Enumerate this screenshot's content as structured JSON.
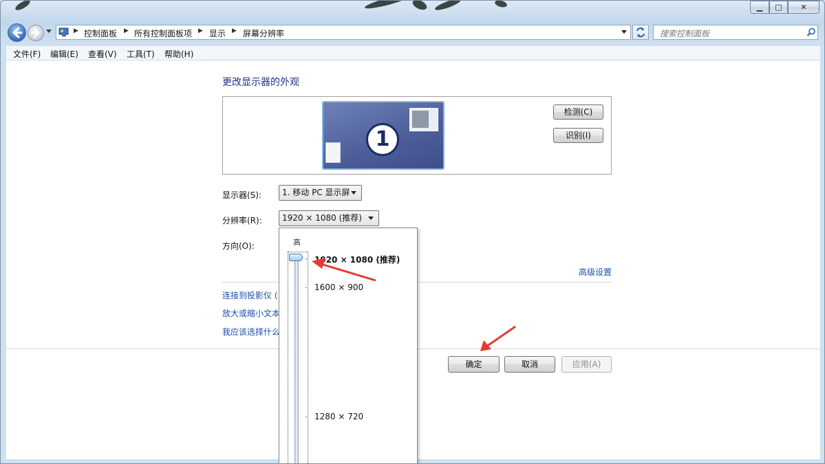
{
  "window": {
    "minimize_glyph": "▁",
    "maximize_glyph": "□",
    "close_glyph": "✕"
  },
  "address": {
    "crumbs": [
      "控制面板",
      "所有控制面板项",
      "显示",
      "屏幕分辨率"
    ],
    "dropdown_icon": "chevron-down-icon",
    "refresh_icon": "refresh-icon"
  },
  "search": {
    "placeholder": "搜索控制面板"
  },
  "menu": {
    "file": "文件(F)",
    "edit": "编辑(E)",
    "view": "查看(V)",
    "tools": "工具(T)",
    "help": "帮助(H)"
  },
  "page": {
    "title": "更改显示器的外观",
    "monitor_number": "1",
    "detect_button": "检测(C)",
    "identify_button": "识别(I)",
    "display_label": "显示器(S):",
    "display_value": "1. 移动 PC 显示屏",
    "resolution_label": "分辨率(R):",
    "resolution_value": "1920 × 1080 (推荐)",
    "orientation_label": "方向(O):",
    "advanced_link": "高级设置",
    "links": {
      "projector": "连接到投影仪 (",
      "text_size": "放大或缩小文本",
      "which": "我应该选择什么"
    },
    "ok_button": "确定",
    "cancel_button": "取消",
    "apply_button": "应用(A)"
  },
  "resolution_dropdown": {
    "high_label": "高",
    "options": [
      "1920 × 1080 (推荐)",
      "1600 × 900",
      "1280 × 720"
    ],
    "selected": "1920 × 1080 (推荐)"
  },
  "colors": {
    "link": "#1e50a2",
    "title": "#1e3287",
    "annotation_arrow": "#e53a33"
  }
}
